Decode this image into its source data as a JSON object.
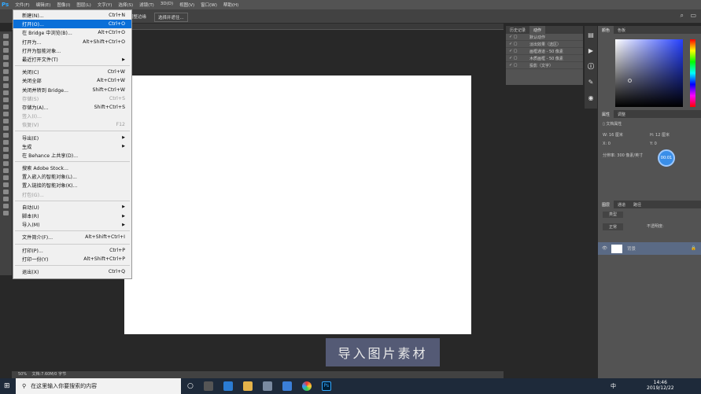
{
  "menubar": {
    "logo": "Ps",
    "items": [
      "文件(F)",
      "编辑(E)",
      "图像(I)",
      "图层(L)",
      "文字(Y)",
      "选择(S)",
      "滤镜(T)",
      "3D(D)",
      "视图(V)",
      "窗口(W)",
      "帮助(H)"
    ]
  },
  "options": {
    "btn1": "选择并遮住...",
    "btn0": "调整边缘"
  },
  "file_menu": [
    {
      "label": "新建(N)...",
      "shortcut": "Ctrl+N"
    },
    {
      "label": "打开(O)...",
      "shortcut": "Ctrl+O",
      "highlighted": true
    },
    {
      "label": "在 Bridge 中浏览(B)...",
      "shortcut": "Alt+Ctrl+O"
    },
    {
      "label": "打开为...",
      "shortcut": "Alt+Shift+Ctrl+O"
    },
    {
      "label": "打开为智能对象...",
      "shortcut": ""
    },
    {
      "label": "最近打开文件(T)",
      "shortcut": "",
      "submenu": true,
      "sep_after": true
    },
    {
      "label": "关闭(C)",
      "shortcut": "Ctrl+W"
    },
    {
      "label": "关闭全部",
      "shortcut": "Alt+Ctrl+W"
    },
    {
      "label": "关闭并转到 Bridge...",
      "shortcut": "Shift+Ctrl+W"
    },
    {
      "label": "存储(S)",
      "shortcut": "Ctrl+S",
      "disabled": true
    },
    {
      "label": "存储为(A)...",
      "shortcut": "Shift+Ctrl+S"
    },
    {
      "label": "签入(I)...",
      "shortcut": "",
      "disabled": true
    },
    {
      "label": "恢复(V)",
      "shortcut": "F12",
      "disabled": true,
      "sep_after": true
    },
    {
      "label": "导出(E)",
      "shortcut": "",
      "submenu": true
    },
    {
      "label": "生成",
      "shortcut": "",
      "submenu": true
    },
    {
      "label": "在 Behance 上共享(D)...",
      "shortcut": "",
      "sep_after": true
    },
    {
      "label": "搜索 Adobe Stock...",
      "shortcut": ""
    },
    {
      "label": "置入嵌入的智能对象(L)...",
      "shortcut": ""
    },
    {
      "label": "置入链接的智能对象(K)...",
      "shortcut": ""
    },
    {
      "label": "打包(G)...",
      "shortcut": "",
      "disabled": true,
      "sep_after": true
    },
    {
      "label": "自动(U)",
      "shortcut": "",
      "submenu": true
    },
    {
      "label": "脚本(R)",
      "shortcut": "",
      "submenu": true
    },
    {
      "label": "导入(M)",
      "shortcut": "",
      "submenu": true,
      "sep_after": true
    },
    {
      "label": "文件简介(F)...",
      "shortcut": "Alt+Shift+Ctrl+I",
      "sep_after": true
    },
    {
      "label": "打印(P)...",
      "shortcut": "Ctrl+P"
    },
    {
      "label": "打印一份(Y)",
      "shortcut": "Alt+Shift+Ctrl+P",
      "sep_after": true
    },
    {
      "label": "退出(X)",
      "shortcut": "Ctrl+Q"
    }
  ],
  "actions_panel": {
    "tabs": [
      "历史记录",
      "动作"
    ],
    "rows": [
      "默认动作",
      "淡出效果（选区）",
      "画框通道 - 50 像素",
      "木质画框 - 50 像素",
      "投影（文字）"
    ]
  },
  "color_panel": {
    "tabs": [
      "颜色",
      "色板"
    ]
  },
  "properties_panel": {
    "tabs": [
      "属性",
      "调整"
    ],
    "title": "文档属性",
    "w": "W: 16 厘米",
    "h": "H: 12 厘米",
    "x": "X: 0",
    "y": "Y: 0",
    "resolution": "分辨率: 300 像素/英寸",
    "badge": "00:01"
  },
  "layers_panel": {
    "tabs": [
      "图层",
      "通道",
      "路径"
    ],
    "kind": "类型",
    "mode": "正常",
    "opacity": "不透明度:",
    "layer_name": "背景"
  },
  "status": {
    "zoom": "50%",
    "doc": "文档:7.60M/0 字节"
  },
  "caption": "导入图片素材",
  "taskbar": {
    "search": "在这里输入你要搜索的内容",
    "time": "14:46",
    "date": "2019/12/22",
    "ime": "中"
  }
}
